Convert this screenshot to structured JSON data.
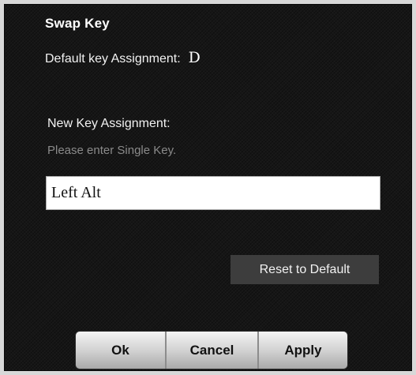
{
  "dialog": {
    "title": "Swap Key",
    "default_label": "Default key Assignment:",
    "default_key": "D",
    "new_label": "New Key Assignment:",
    "hint": "Please enter Single Key.",
    "input_value": "Left Alt",
    "reset_label": "Reset to Default"
  },
  "buttons": {
    "ok": "Ok",
    "cancel": "Cancel",
    "apply": "Apply"
  },
  "colors": {
    "panel_bg": "#161616",
    "frame_bg": "#d8d8d8",
    "reset_bg": "#3d3d3d",
    "hint_text": "#8a8a8a"
  }
}
